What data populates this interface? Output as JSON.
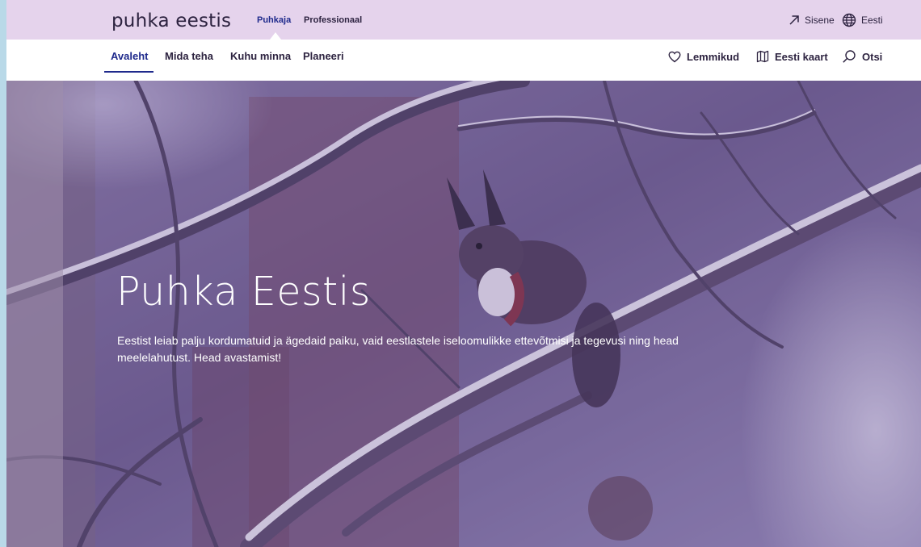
{
  "site": {
    "logo": "puhka eestis"
  },
  "audience": {
    "items": [
      {
        "label": "Puhkaja",
        "active": true
      },
      {
        "label": "Professionaal",
        "active": false
      }
    ]
  },
  "utility": {
    "login_label": "Sisene",
    "login_icon": "arrow-up-right-icon",
    "language_label": "Eesti",
    "language_icon": "globe-icon"
  },
  "nav": {
    "items": [
      {
        "label": "Avaleht",
        "active": true
      },
      {
        "label": "Mida teha",
        "active": false
      },
      {
        "label": "Kuhu minna",
        "active": false
      },
      {
        "label": "Planeeri",
        "active": false
      }
    ],
    "right": [
      {
        "label": "Lemmikud",
        "icon": "heart-icon"
      },
      {
        "label": "Eesti kaart",
        "icon": "map-icon"
      },
      {
        "label": "Otsi",
        "icon": "search-icon"
      }
    ]
  },
  "hero": {
    "title": "Puhka Eestis",
    "text": "Eestist leiab palju kordumatuid ja ägedaid paiku, vaid eestlastele iseloomulikke ettevõtmisi ja tegevusi ning head meelelahutust. Head avastamist!"
  },
  "colors": {
    "topbar": "#e5d3ec",
    "accent": "#1f2a8c",
    "text": "#2d2340",
    "page_border": "#b9d9e8"
  }
}
